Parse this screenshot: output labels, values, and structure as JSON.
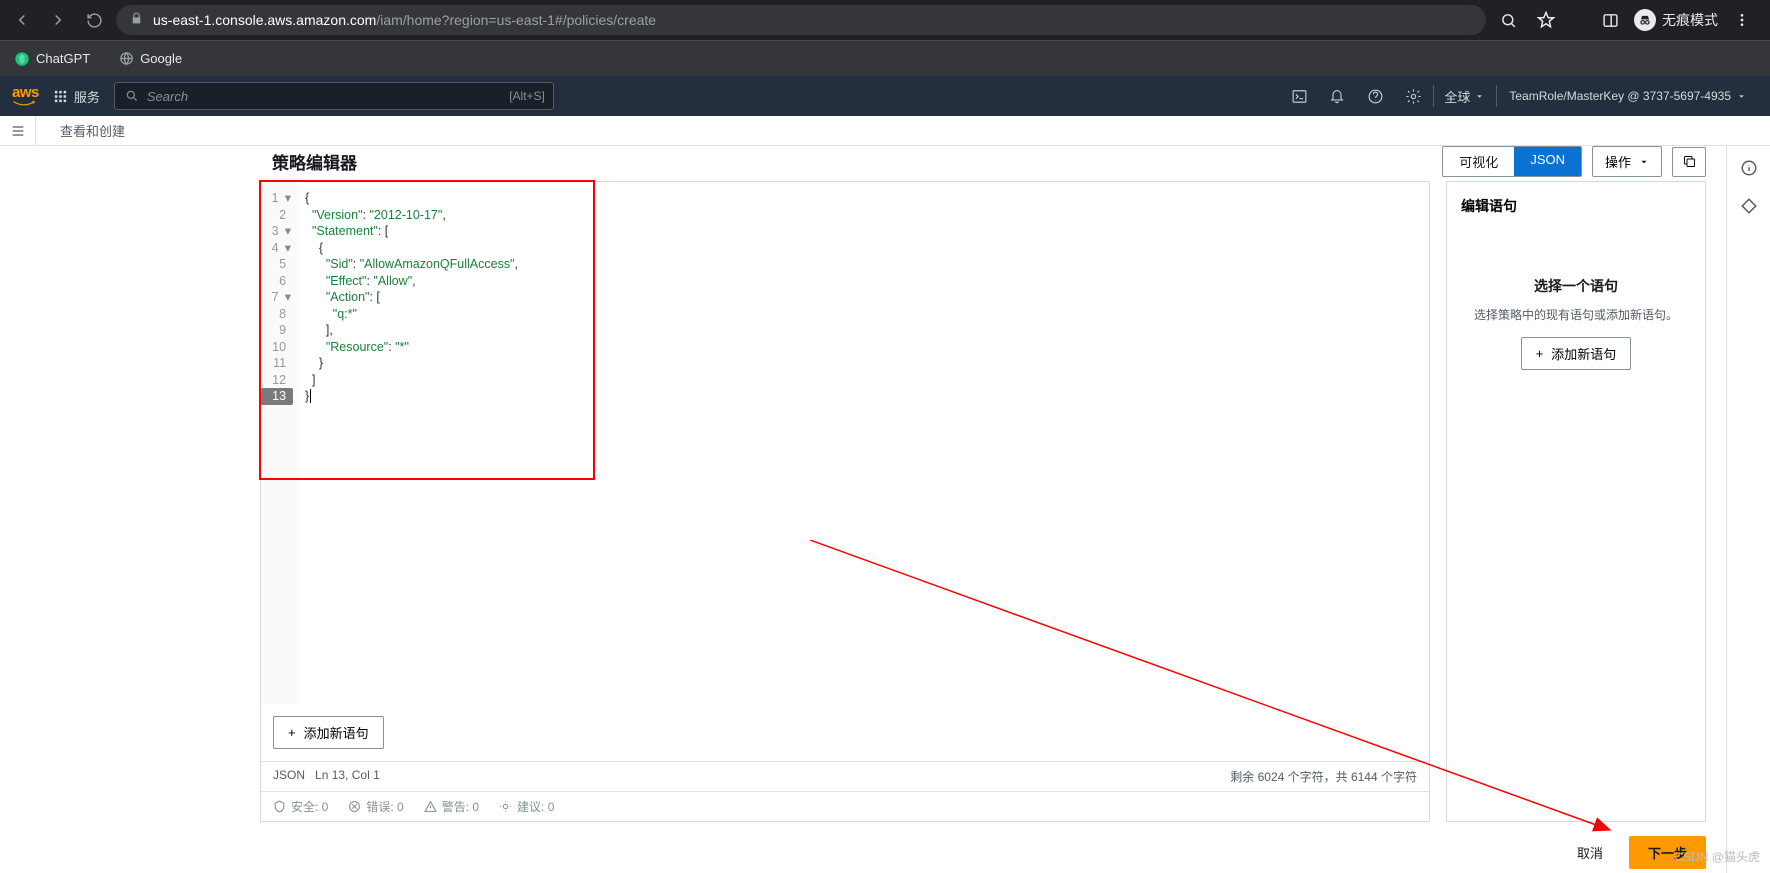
{
  "browser": {
    "url_domain": "us-east-1.console.aws.amazon.com",
    "url_path": "/iam/home?region=us-east-1#/policies/create",
    "incognito_label": "无痕模式"
  },
  "bookmarks": [
    {
      "label": "ChatGPT"
    },
    {
      "label": "Google"
    }
  ],
  "aws_nav": {
    "logo": "aws",
    "services_label": "服务",
    "search_placeholder": "Search",
    "search_shortcut": "[Alt+S]",
    "region_label": "全球",
    "account_label": "TeamRole/MasterKey @ 3737-5697-4935"
  },
  "sub_bar": {
    "crumb": "查看和创建"
  },
  "editor": {
    "title": "策略编辑器",
    "seg_visual": "可视化",
    "seg_json": "JSON",
    "actions_label": "操作",
    "add_statement": "添加新语句",
    "status_left_mode": "JSON",
    "status_left_pos": "Ln 13, Col 1",
    "status_right": "剩余 6024 个字符，共 6144 个字符",
    "diag_security": "安全: 0",
    "diag_errors": "错误: 0",
    "diag_warnings": "警告: 0",
    "diag_suggestions": "建议: 0",
    "code": {
      "l1": "{",
      "l2_k": "\"Version\"",
      "l2_v": "\"2012-10-17\"",
      "l3_k": "\"Statement\"",
      "l5_k": "\"Sid\"",
      "l5_v": "\"AllowAmazonQFullAccess\"",
      "l6_k": "\"Effect\"",
      "l6_v": "\"Allow\"",
      "l7_k": "\"Action\"",
      "l8_v": "\"q:*\"",
      "l10_k": "\"Resource\"",
      "l10_v": "\"*\""
    }
  },
  "side": {
    "title": "编辑语句",
    "empty_heading": "选择一个语句",
    "empty_text": "选择策略中的现有语句或添加新语句。",
    "add_btn": "添加新语句"
  },
  "footer": {
    "cancel": "取消",
    "next": "下一步"
  },
  "watermark": "CSDN @猫头虎"
}
